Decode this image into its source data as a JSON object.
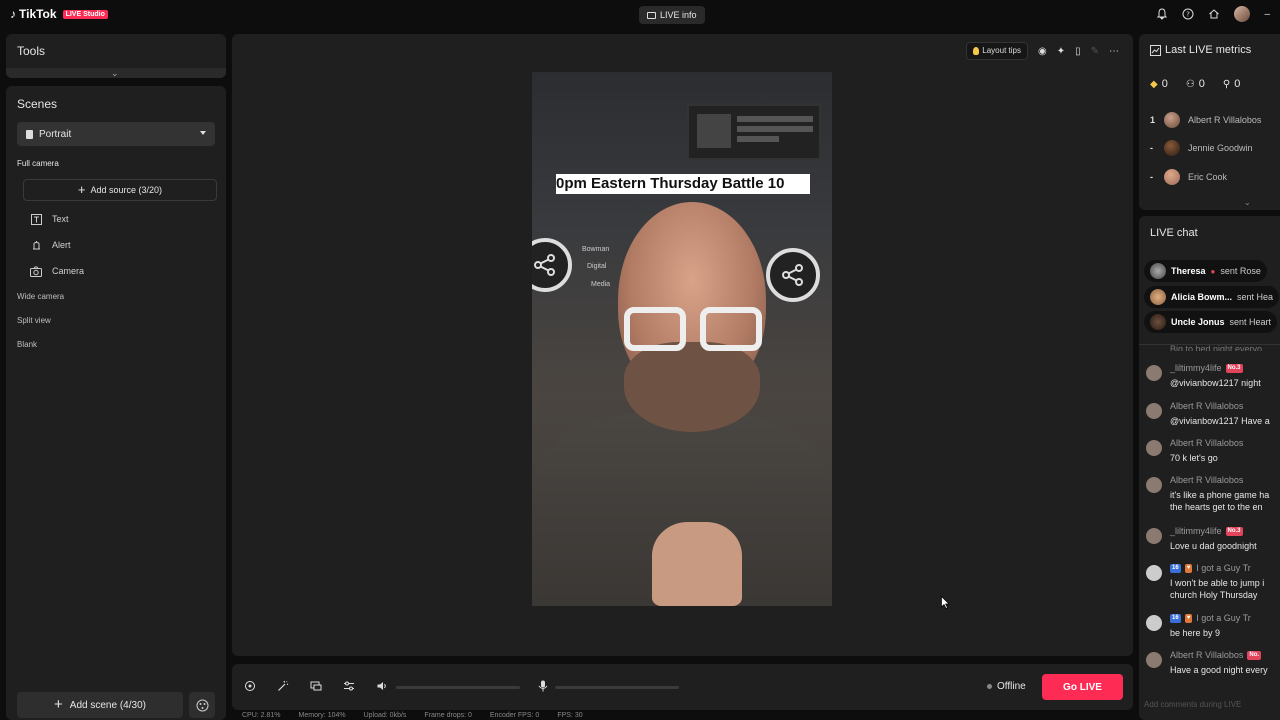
{
  "topbar": {
    "brand": "TikTok",
    "brand_badge": "LIVE Studio",
    "live_info_label": "LIVE info",
    "icons": [
      "bell-icon",
      "help-icon",
      "home-icon",
      "avatar"
    ]
  },
  "tools": {
    "title": "Tools"
  },
  "scenes": {
    "title": "Scenes",
    "selected": "Portrait",
    "groups": [
      "Full camera",
      "Wide camera",
      "Split view",
      "Blank"
    ],
    "add_source_label": "Add source (3/20)",
    "sources": [
      {
        "label": "Text",
        "icon": "text-icon"
      },
      {
        "label": "Alert",
        "icon": "alert-icon"
      },
      {
        "label": "Camera",
        "icon": "camera-icon"
      }
    ],
    "add_scene_label": "Add scene (4/30)"
  },
  "canvas": {
    "layout_tips_label": "Layout tips",
    "video_banner": "0pm Eastern Thursday  Battle 10",
    "video_brand": [
      "Bowman",
      "Digital",
      "Media"
    ]
  },
  "controls": {
    "status": "Offline",
    "go_live": "Go LIVE"
  },
  "stats": [
    "CPU: 2.81%",
    "Memory: 104%",
    "Upload: 0kb/s",
    "Frame drops: 0",
    "Encoder FPS: 0",
    "FPS: 30"
  ],
  "metrics": {
    "title": "Last LIVE metrics",
    "values": [
      "0",
      "0",
      "0"
    ],
    "ranking": [
      {
        "rank": "1",
        "name": "Albert R Villalobos"
      },
      {
        "rank": "-",
        "name": "Jennie Goodwin"
      },
      {
        "rank": "-",
        "name": "Eric Cook"
      }
    ]
  },
  "chat": {
    "title": "LIVE chat",
    "gifts": [
      {
        "user": "Theresa",
        "text": "sent Rose"
      },
      {
        "user": "Alicia Bowm...",
        "text": "sent Hea"
      },
      {
        "user": "Uncle Jonus",
        "text": "sent Heart"
      }
    ],
    "partial_top": "Big to bed night everyo",
    "messages": [
      {
        "user": "_liltimmy4life",
        "badge": "No.3",
        "text": "@vivianbow1217 night"
      },
      {
        "user": "Albert R Villalobos",
        "badge": "",
        "text": "@vivianbow1217 Have a"
      },
      {
        "user": "Albert R Villalobos",
        "badge": "",
        "text": "70 k let's go"
      },
      {
        "user": "Albert R Villalobos",
        "badge": "",
        "text": "it's like a phone game ha\nthe hearts get to the en"
      },
      {
        "user": "_liltimmy4life",
        "badge": "No.3",
        "text": "Love u dad goodnight"
      },
      {
        "user": "I got a Guy Tr",
        "badge": "16",
        "text": "I won't be able to jump i\nchurch Holy Thursday"
      },
      {
        "user": "I got a Guy Tr",
        "badge": "16",
        "text": "be here by 9"
      },
      {
        "user": "Albert R Villalobos",
        "badge": "No.",
        "text": "Have a good night every"
      }
    ],
    "input_placeholder": "Add comments during LIVE"
  }
}
